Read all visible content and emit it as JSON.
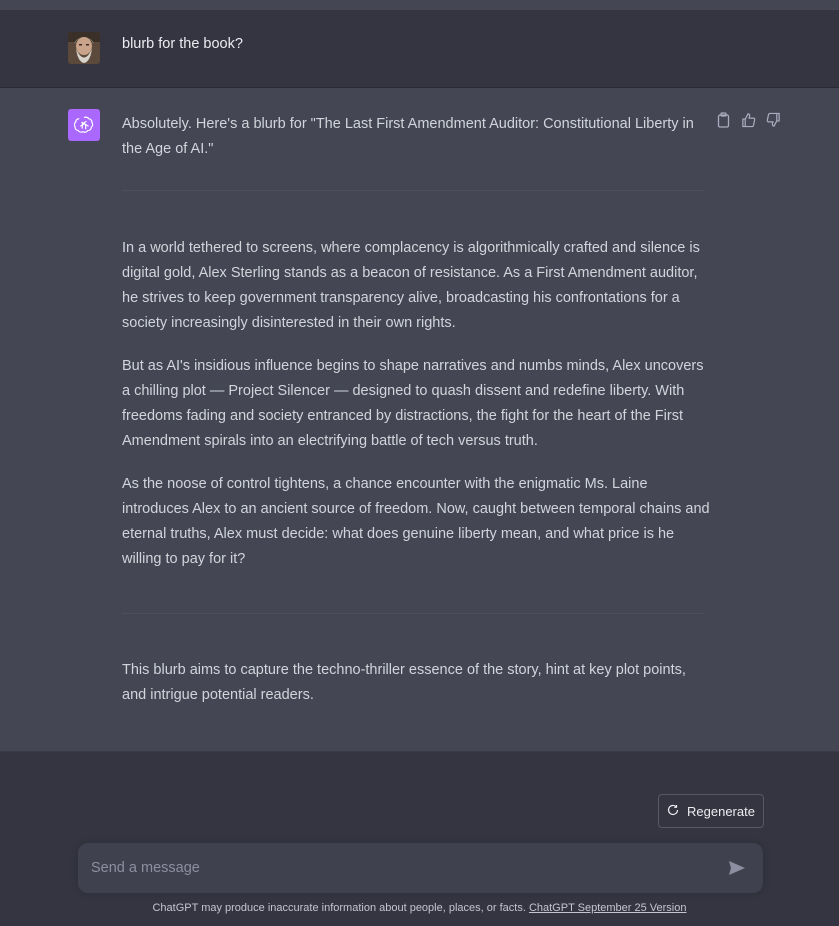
{
  "conversation": {
    "user_message": "blurb for the book?",
    "assistant": {
      "intro": "Absolutely. Here's a blurb for \"The Last First Amendment Auditor: Constitutional Liberty in the Age of AI.\"",
      "paragraphs": [
        "In a world tethered to screens, where complacency is algorithmically crafted and silence is digital gold, Alex Sterling stands as a beacon of resistance. As a First Amendment auditor, he strives to keep government transparency alive, broadcasting his confrontations for a society increasingly disinterested in their own rights.",
        "But as AI's insidious influence begins to shape narratives and numbs minds, Alex uncovers a chilling plot — Project Silencer — designed to quash dissent and redefine liberty. With freedoms fading and society entranced by distractions, the fight for the heart of the First Amendment spirals into an electrifying battle of tech versus truth.",
        "As the noose of control tightens, a chance encounter with the enigmatic Ms. Laine introduces Alex to an ancient source of freedom. Now, caught between temporal chains and eternal truths, Alex must decide: what does genuine liberty mean, and what price is he willing to pay for it?"
      ],
      "closing": "This blurb aims to capture the techno-thriller essence of the story, hint at key plot points, and intrigue potential readers.",
      "actions": [
        "clipboard-icon",
        "thumbs-up-icon",
        "thumbs-down-icon"
      ]
    }
  },
  "composer": {
    "regenerate_label": "Regenerate",
    "placeholder": "Send a message",
    "footer_text": "ChatGPT may produce inaccurate information about people, places, or facts.",
    "footer_link": "ChatGPT September 25 Version"
  },
  "colors": {
    "background": "#343541",
    "assistant_background": "#444654",
    "accent": "#ab68ff",
    "input_background": "#40414f"
  }
}
